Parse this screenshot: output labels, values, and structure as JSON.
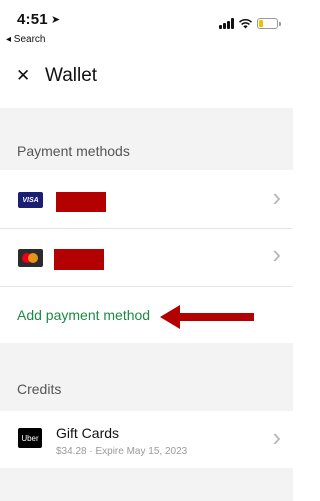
{
  "status_bar": {
    "time": "4:51",
    "back_app": "◂ Search"
  },
  "header": {
    "close_symbol": "✕",
    "title": "Wallet"
  },
  "payment_methods": {
    "section_label": "Payment methods",
    "cards": [
      {
        "brand": "VISA",
        "icon": "visa-logo",
        "number": ""
      },
      {
        "brand": "Mastercard",
        "icon": "mastercard-logo",
        "number": ""
      }
    ],
    "add_label": "Add payment method"
  },
  "credits": {
    "section_label": "Credits",
    "item": {
      "logo_text": "Uber",
      "title": "Gift Cards",
      "subtitle": "$34.28 · Expire May 15, 2023"
    }
  },
  "colors": {
    "accent_green": "#1a8a43",
    "annotation_red": "#b30000"
  }
}
